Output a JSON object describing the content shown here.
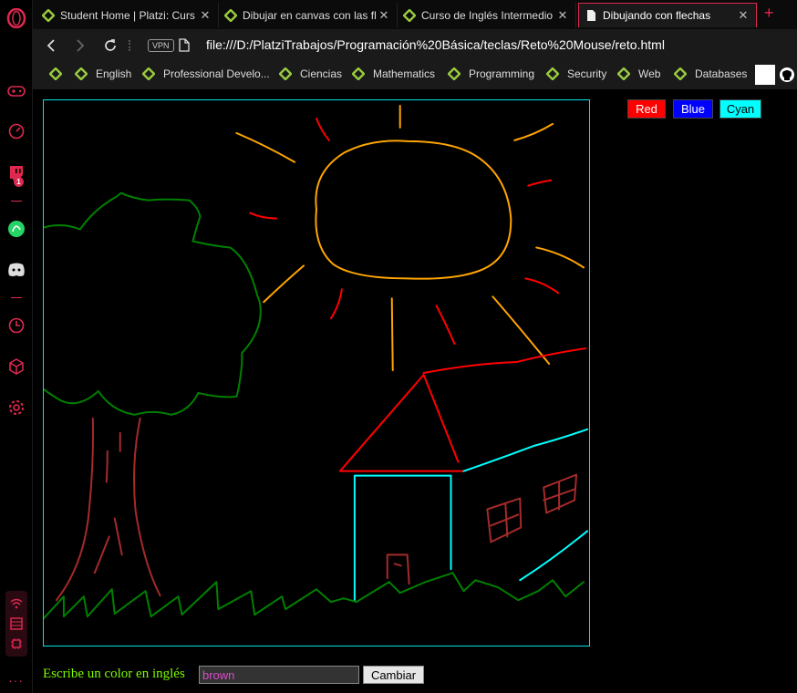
{
  "tabs": [
    {
      "title": "Student Home | Platzi: Curs",
      "active": false
    },
    {
      "title": "Dibujar en canvas con las fl",
      "active": false
    },
    {
      "title": "Curso de Inglés Intermedio",
      "active": false
    },
    {
      "title": "Dibujando con flechas",
      "active": true
    }
  ],
  "address": {
    "url": "file:///D:/PlatziTrabajos/Programación%20Básica/teclas/Reto%20Mouse/reto.html",
    "vpn_label": "VPN"
  },
  "bookmarks": [
    "English",
    "Professional Develo...",
    "Ciencias",
    "Mathematics",
    "Programming",
    "Security",
    "Web",
    "Databases"
  ],
  "sidebar": {
    "twitch_badge": "1"
  },
  "page": {
    "buttons": [
      {
        "label": "Red",
        "bg": "#ff0000",
        "fg": "#ffffff"
      },
      {
        "label": "Blue",
        "bg": "#0000ff",
        "fg": "#ffffff"
      },
      {
        "label": "Cyan",
        "bg": "#00ffff",
        "fg": "#000000"
      }
    ],
    "prompt_label": "Escribe un color en inglés",
    "color_input_value": "brown",
    "change_button": "Cambiar"
  },
  "colors": {
    "opera_red": "#e0284f",
    "canvas_border": "#00e5e5",
    "label_green": "#7cfc00",
    "input_text": "#d84cc8",
    "stroke_orange": "#ffa500",
    "stroke_red": "#ff0000",
    "stroke_green": "#008000",
    "stroke_brown": "#a52a2a",
    "stroke_cyan": "#00ffff"
  }
}
